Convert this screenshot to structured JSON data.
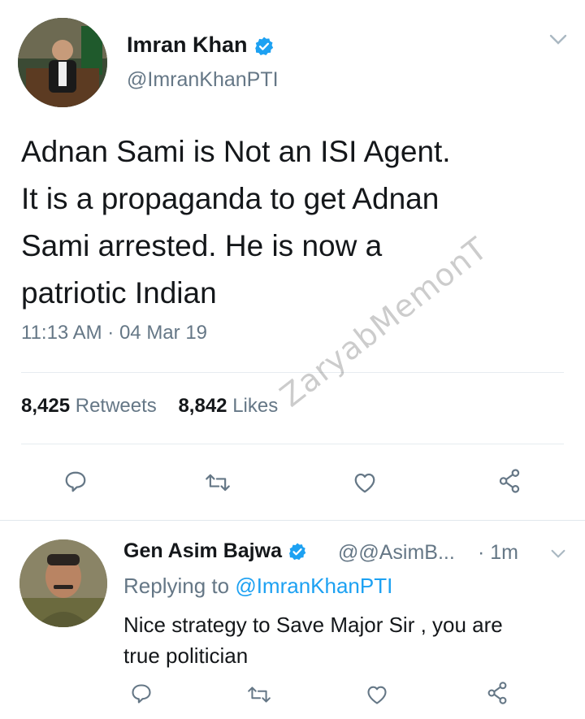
{
  "tweet": {
    "author_name": "Imran Khan",
    "author_handle": "@ImranKhanPTI",
    "text_lines": [
      "Adnan Sami is Not an ISI Agent.",
      "It is a propaganda to get Adnan",
      "Sami arrested. He is now a",
      "patriotic Indian"
    ],
    "timestamp": "11:13 AM · 04 Mar 19",
    "retweet_count": "8,425",
    "retweet_label": "Retweets",
    "like_count": "8,842",
    "like_label": "Likes",
    "icons": [
      "reply-icon",
      "retweet-icon",
      "like-icon",
      "share-icon"
    ]
  },
  "watermark": "ZaryabMemonT",
  "reply": {
    "author_name": "Gen Asim Bajwa",
    "author_handle": "@@AsimB...",
    "time": "· 1m",
    "replying_prefix": "Replying to",
    "replying_to": "@ImranKhanPTI",
    "text_lines": [
      "Nice strategy to Save Major Sir , you are",
      "true politician"
    ],
    "icons": [
      "reply-icon",
      "retweet-icon",
      "like-icon",
      "share-icon"
    ]
  },
  "colors": {
    "verified": "#1da1f2",
    "secondary_text": "#657786",
    "link": "#1da1f2"
  }
}
